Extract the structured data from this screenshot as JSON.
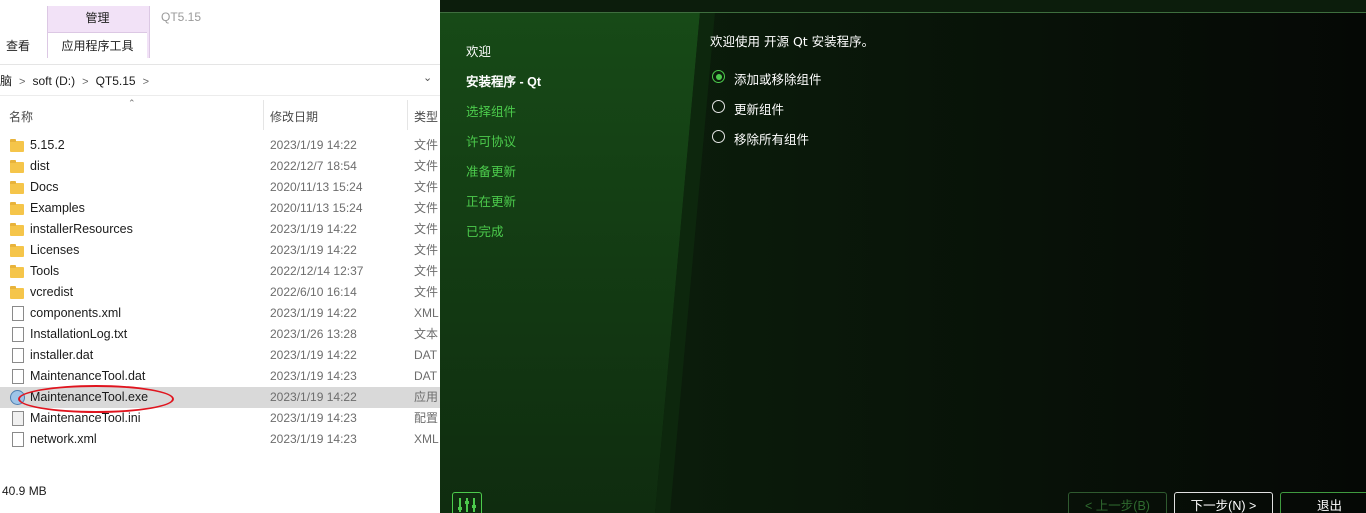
{
  "explorer": {
    "ribbon": {
      "context_group_title": "管理",
      "context_tab": "应用程序工具",
      "view_tab": "查看",
      "window_title": "QT5.15"
    },
    "address": {
      "crumbs": [
        "脑",
        "soft (D:)",
        "QT5.15"
      ]
    },
    "columns": {
      "name": "名称",
      "date": "修改日期",
      "type": "类型"
    },
    "files": [
      {
        "name": "5.15.2",
        "date": "2023/1/19 14:22",
        "type": "文件",
        "icon": "folder-icon"
      },
      {
        "name": "dist",
        "date": "2022/12/7 18:54",
        "type": "文件",
        "icon": "folder-icon"
      },
      {
        "name": "Docs",
        "date": "2020/11/13 15:24",
        "type": "文件",
        "icon": "folder-icon"
      },
      {
        "name": "Examples",
        "date": "2020/11/13 15:24",
        "type": "文件",
        "icon": "folder-icon"
      },
      {
        "name": "installerResources",
        "date": "2023/1/19 14:22",
        "type": "文件",
        "icon": "folder-icon"
      },
      {
        "name": "Licenses",
        "date": "2023/1/19 14:22",
        "type": "文件",
        "icon": "folder-icon"
      },
      {
        "name": "Tools",
        "date": "2022/12/14 12:37",
        "type": "文件",
        "icon": "folder-icon"
      },
      {
        "name": "vcredist",
        "date": "2022/6/10 16:14",
        "type": "文件",
        "icon": "folder-icon"
      },
      {
        "name": "components.xml",
        "date": "2023/1/19 14:22",
        "type": "XML",
        "icon": "file-icon"
      },
      {
        "name": "InstallationLog.txt",
        "date": "2023/1/26 13:28",
        "type": "文本",
        "icon": "file-icon"
      },
      {
        "name": "installer.dat",
        "date": "2023/1/19 14:22",
        "type": "DAT",
        "icon": "file-icon"
      },
      {
        "name": "MaintenanceTool.dat",
        "date": "2023/1/19 14:23",
        "type": "DAT",
        "icon": "file-icon"
      },
      {
        "name": "MaintenanceTool.exe",
        "date": "2023/1/19 14:22",
        "type": "应用",
        "icon": "exe-icon",
        "selected": true
      },
      {
        "name": "MaintenanceTool.ini",
        "date": "2023/1/19 14:23",
        "type": "配置",
        "icon": "ini-icon"
      },
      {
        "name": "network.xml",
        "date": "2023/1/19 14:23",
        "type": "XML",
        "icon": "file-icon"
      }
    ],
    "status": "40.9 MB"
  },
  "installer": {
    "nav": [
      {
        "label": "欢迎",
        "state": "done"
      },
      {
        "label": "安装程序 - Qt",
        "state": "current"
      },
      {
        "label": "选择组件",
        "state": "pending"
      },
      {
        "label": "许可协议",
        "state": "pending"
      },
      {
        "label": "准备更新",
        "state": "pending"
      },
      {
        "label": "正在更新",
        "state": "pending"
      },
      {
        "label": "已完成",
        "state": "pending"
      }
    ],
    "welcome": "欢迎使用 开源 Qt 安装程序。",
    "options": [
      {
        "label": "添加或移除组件",
        "selected": true
      },
      {
        "label": "更新组件",
        "selected": false
      },
      {
        "label": "移除所有组件",
        "selected": false
      }
    ],
    "buttons": {
      "back": "< 上一步(B)",
      "next": "下一步(N) >",
      "quit": "退出"
    },
    "colors": {
      "accent": "#4ccb4c",
      "background": "#0c1d0c"
    }
  }
}
